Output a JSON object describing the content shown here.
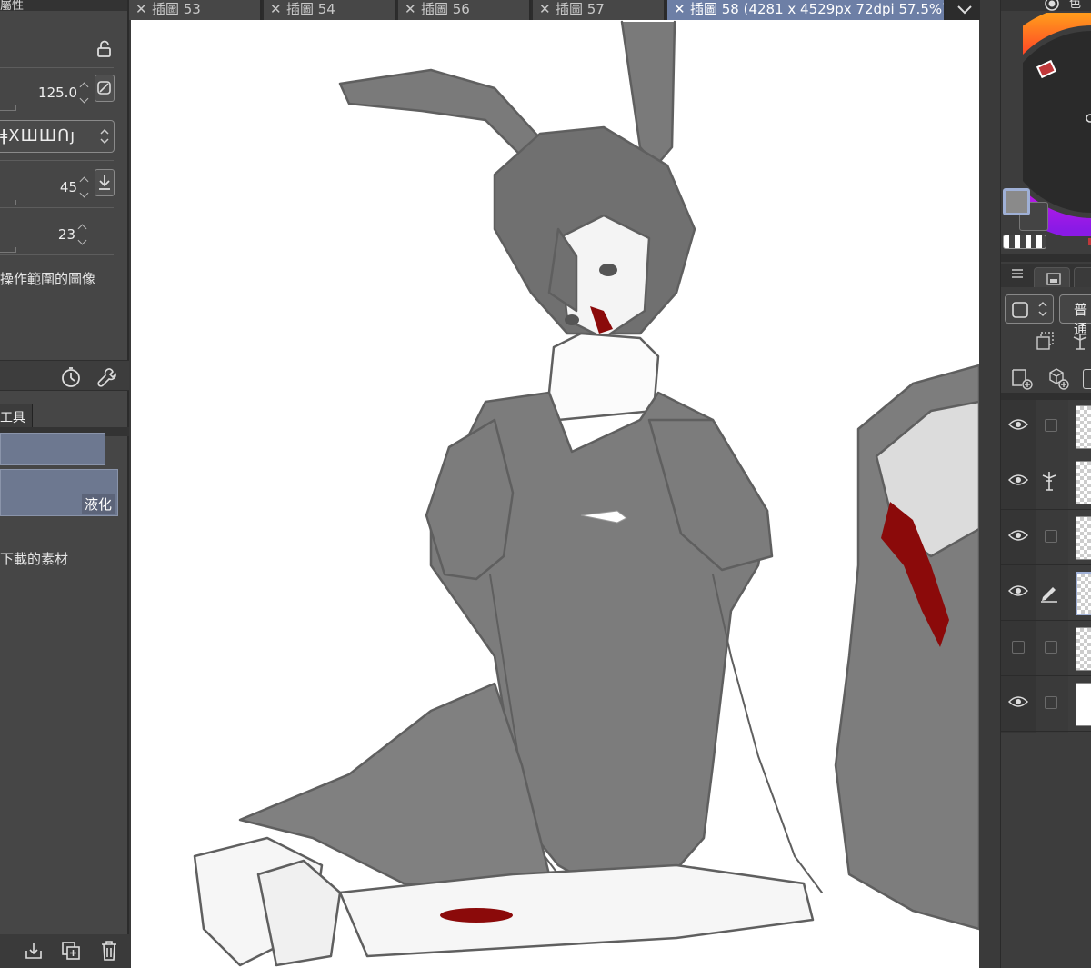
{
  "left_panel": {
    "header_label": "屬性",
    "size_value": "125.0",
    "brush_preview_text": "ǂXШШՈյ",
    "angle_value": "45",
    "count_value": "23",
    "reference_text": "操作範圍的圖像",
    "tool_tab_label": "工具",
    "liquify_label": "液化",
    "materials_text": "下載的素材"
  },
  "tabs": [
    {
      "label": "插圖 53",
      "active": false
    },
    {
      "label": "插圖 54",
      "active": false
    },
    {
      "label": "插圖 56",
      "active": false
    },
    {
      "label": "插圖 57",
      "active": false
    },
    {
      "label": "插圖 58 (4281 x 4529px 72dpi 57.5%)",
      "active": true
    }
  ],
  "right_panel": {
    "color_title": "色環",
    "blend_mode": "普通",
    "colors": {
      "main": "#8a8a8a",
      "sub": "#444444",
      "accent": "#6d7fa6"
    },
    "layers": [
      {
        "visible": true,
        "marker": "none",
        "thumb": "transparent"
      },
      {
        "visible": true,
        "marker": "lighthouse-icon",
        "thumb": "transparent"
      },
      {
        "visible": true,
        "marker": "none",
        "thumb": "transparent"
      },
      {
        "visible": true,
        "marker": "pen-icon",
        "thumb": "transparent",
        "selected": true
      },
      {
        "visible": false,
        "marker": "none",
        "thumb": "transparent"
      },
      {
        "visible": true,
        "marker": "none",
        "thumb": "white"
      }
    ]
  },
  "icons": {
    "lock": "lock-open-icon",
    "timer": "timer-icon",
    "wrench": "wrench-icon",
    "import": "import-icon",
    "duplicate": "duplicate-icon",
    "trash": "trash-icon",
    "tab_close": "close-icon",
    "tab_menu": "chevron-down-icon"
  }
}
